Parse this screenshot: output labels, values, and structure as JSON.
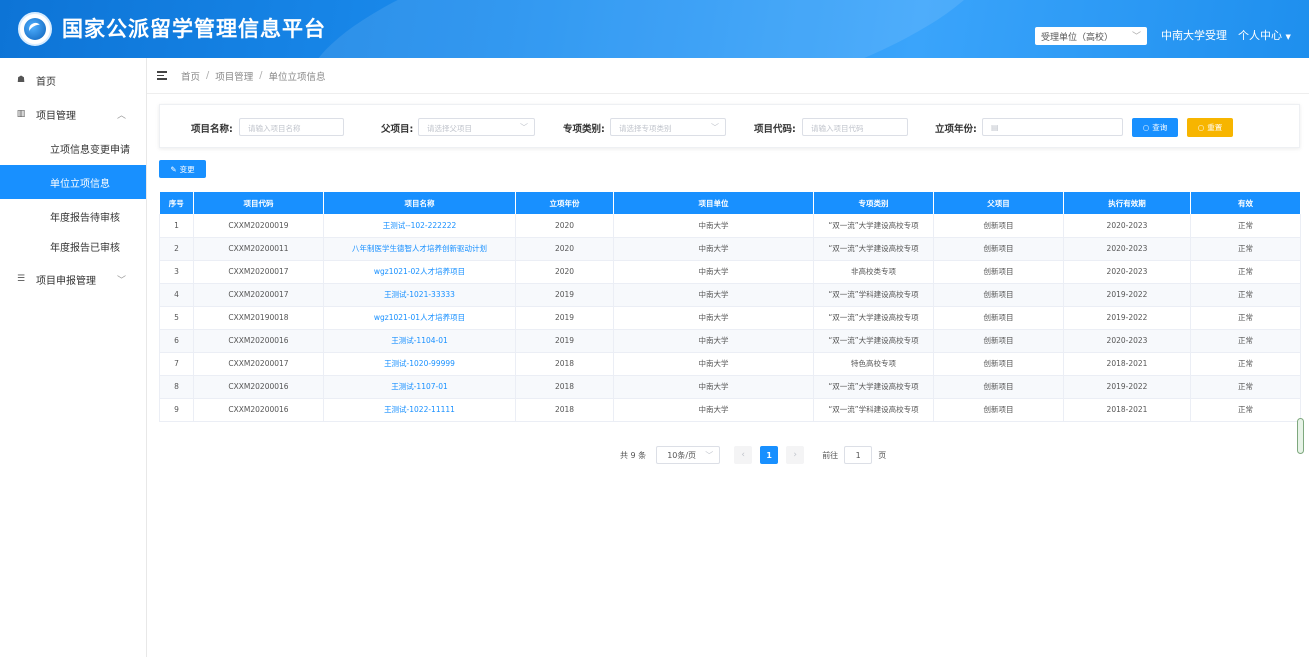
{
  "header": {
    "title": "国家公派留学管理信息平台",
    "unit_select": "受理单位（高校）",
    "user": "中南大学受理",
    "personal_center": "个人中心"
  },
  "sidebar": {
    "home": "首页",
    "project_mgmt": "项目管理",
    "sub_items": [
      "立项信息变更申请",
      "单位立项信息",
      "年度报告待审核",
      "年度报告已审核"
    ],
    "project_apply": "项目申报管理"
  },
  "breadcrumb": [
    "首页",
    "项目管理",
    "单位立项信息"
  ],
  "filter": {
    "name_label": "项目名称:",
    "name_placeholder": "请输入项目名称",
    "parent_label": "父项目:",
    "parent_placeholder": "请选择父项目",
    "type_label": "专项类别:",
    "type_placeholder": "请选择专项类别",
    "code_label": "项目代码:",
    "code_placeholder": "请输入项目代码",
    "year_label": "立项年份:",
    "query": "查询",
    "reset": "重置"
  },
  "change_button": "变更",
  "table": {
    "headers": [
      "序号",
      "项目代码",
      "项目名称",
      "立项年份",
      "项目单位",
      "专项类别",
      "父项目",
      "执行有效期",
      "有效"
    ],
    "rows": [
      [
        "1",
        "CXXM20200019",
        "王测试--102-222222",
        "2020",
        "中南大学",
        "“双一流”大学建设高校专项",
        "创新项目",
        "2020-2023",
        "正常"
      ],
      [
        "2",
        "CXXM20200011",
        "八年制医学生德智人才培养创新驱动计划",
        "2020",
        "中南大学",
        "“双一流”大学建设高校专项",
        "创新项目",
        "2020-2023",
        "正常"
      ],
      [
        "3",
        "CXXM20200017",
        "wgz1021-02人才培养项目",
        "2020",
        "中南大学",
        "非高校类专项",
        "创新项目",
        "2020-2023",
        "正常"
      ],
      [
        "4",
        "CXXM20200017",
        "王测试-1021-33333",
        "2019",
        "中南大学",
        "“双一流”学科建设高校专项",
        "创新项目",
        "2019-2022",
        "正常"
      ],
      [
        "5",
        "CXXM20190018",
        "wgz1021-01人才培养项目",
        "2019",
        "中南大学",
        "“双一流”大学建设高校专项",
        "创新项目",
        "2019-2022",
        "正常"
      ],
      [
        "6",
        "CXXM20200016",
        "王测试-1104-01",
        "2019",
        "中南大学",
        "“双一流”大学建设高校专项",
        "创新项目",
        "2020-2023",
        "正常"
      ],
      [
        "7",
        "CXXM20200017",
        "王测试-1020-99999",
        "2018",
        "中南大学",
        "特色高校专项",
        "创新项目",
        "2018-2021",
        "正常"
      ],
      [
        "8",
        "CXXM20200016",
        "王测试-1107-01",
        "2018",
        "中南大学",
        "“双一流”大学建设高校专项",
        "创新项目",
        "2019-2022",
        "正常"
      ],
      [
        "9",
        "CXXM20200016",
        "王测试-1022-11111",
        "2018",
        "中南大学",
        "“双一流”学科建设高校专项",
        "创新项目",
        "2018-2021",
        "正常"
      ]
    ]
  },
  "pagination": {
    "total": "共 9 条",
    "page_size": "10条/页",
    "current_page": "1",
    "goto_label": "前往",
    "goto_value": "1",
    "page_suffix": "页"
  },
  "colors": {
    "primary": "#1890ff",
    "reset": "#f7b500"
  }
}
